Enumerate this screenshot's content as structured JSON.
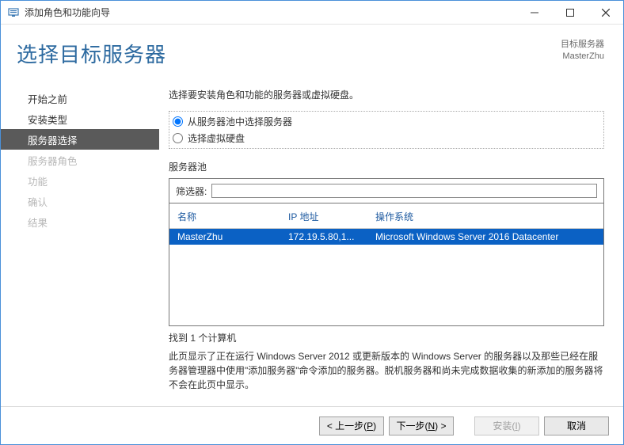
{
  "window": {
    "title": "添加角色和功能向导"
  },
  "header": {
    "page_title": "选择目标服务器",
    "target_label": "目标服务器",
    "target_value": "MasterZhu"
  },
  "sidebar": {
    "items": [
      {
        "label": "开始之前",
        "enabled": true,
        "selected": false
      },
      {
        "label": "安装类型",
        "enabled": true,
        "selected": false
      },
      {
        "label": "服务器选择",
        "enabled": true,
        "selected": true
      },
      {
        "label": "服务器角色",
        "enabled": false,
        "selected": false
      },
      {
        "label": "功能",
        "enabled": false,
        "selected": false
      },
      {
        "label": "确认",
        "enabled": false,
        "selected": false
      },
      {
        "label": "结果",
        "enabled": false,
        "selected": false
      }
    ]
  },
  "main": {
    "instruction": "选择要安装角色和功能的服务器或虚拟硬盘。",
    "radios": {
      "option_pool": "从服务器池中选择服务器",
      "option_vhd": "选择虚拟硬盘",
      "selected": "pool"
    },
    "pool_label": "服务器池",
    "filter_label": "筛选器:",
    "filter_value": "",
    "columns": {
      "name": "名称",
      "ip": "IP 地址",
      "os": "操作系统"
    },
    "rows": [
      {
        "name": "MasterZhu",
        "ip": "172.19.5.80,1...",
        "os": "Microsoft Windows Server 2016 Datacenter",
        "selected": true
      }
    ],
    "count_line": "找到 1 个计算机",
    "description": "此页显示了正在运行 Windows Server 2012 或更新版本的 Windows Server 的服务器以及那些已经在服务器管理器中使用\"添加服务器\"命令添加的服务器。脱机服务器和尚未完成数据收集的新添加的服务器将不会在此页中显示。"
  },
  "footer": {
    "prev": {
      "text": "< 上一步(",
      "key": "P",
      "tail": ")",
      "enabled": true
    },
    "next": {
      "text": "下一步(",
      "key": "N",
      "tail": ") >",
      "enabled": true
    },
    "install": {
      "text": "安装(",
      "key": "I",
      "tail": ")",
      "enabled": false
    },
    "cancel": {
      "text": "取消",
      "enabled": true
    }
  }
}
